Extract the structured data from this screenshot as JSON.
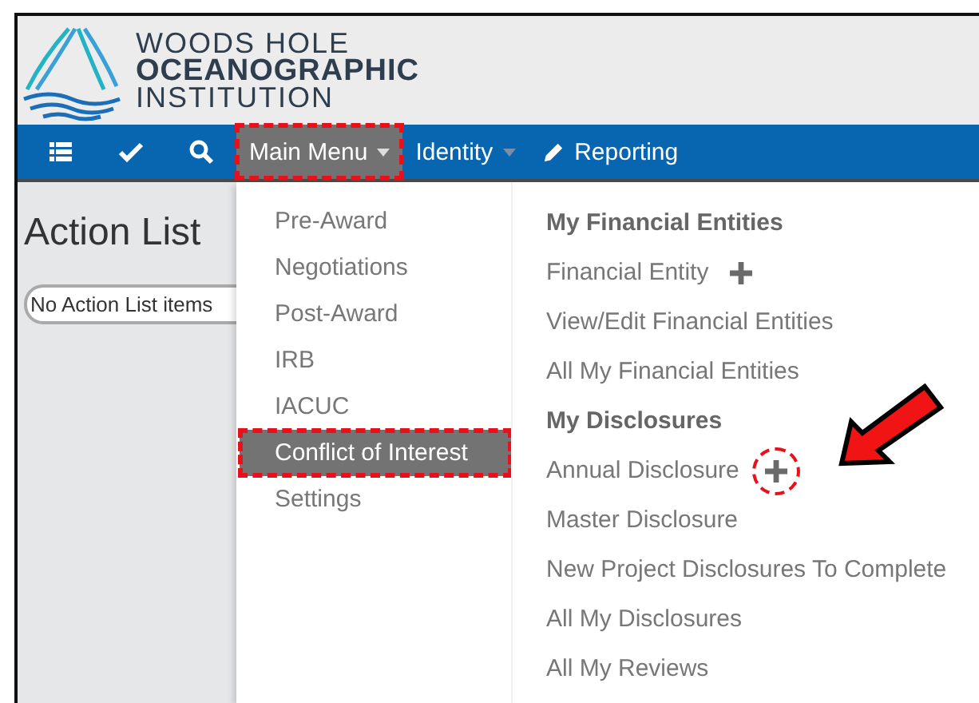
{
  "logo": {
    "lines": [
      "WOODS HOLE",
      "OCEANOGRAPHIC",
      "INSTITUTION"
    ]
  },
  "navbar": {
    "items": [
      {
        "kind": "list-icon",
        "highlighted": false
      },
      {
        "kind": "check-icon",
        "highlighted": false
      },
      {
        "kind": "search-icon",
        "highlighted": false
      },
      {
        "kind": "menu",
        "label": "Main Menu",
        "caret": true,
        "open": true,
        "highlighted": true
      },
      {
        "kind": "menu",
        "label": "Identity",
        "caret": true,
        "open": false,
        "highlighted": false
      },
      {
        "kind": "pencil",
        "label": "Reporting",
        "highlighted": false
      }
    ]
  },
  "action_list": {
    "title": "Action List",
    "message": "No Action List items"
  },
  "main_menu": {
    "items": [
      {
        "label": "Pre-Award",
        "selected": false,
        "highlighted": false
      },
      {
        "label": "Negotiations",
        "selected": false,
        "highlighted": false
      },
      {
        "label": "Post-Award",
        "selected": false,
        "highlighted": false
      },
      {
        "label": "IRB",
        "selected": false,
        "highlighted": false
      },
      {
        "label": "IACUC",
        "selected": false,
        "highlighted": false
      },
      {
        "label": "Conflict of Interest",
        "selected": true,
        "highlighted": true
      },
      {
        "label": "Settings",
        "selected": false,
        "highlighted": false
      }
    ],
    "submenu": [
      {
        "kind": "heading",
        "label": "My Financial Entities"
      },
      {
        "kind": "link",
        "label": "Financial Entity",
        "add": true,
        "annotated": false
      },
      {
        "kind": "link",
        "label": "View/Edit Financial Entities",
        "add": false
      },
      {
        "kind": "link",
        "label": "All My Financial Entities",
        "add": false
      },
      {
        "kind": "heading",
        "label": "My Disclosures"
      },
      {
        "kind": "link",
        "label": "Annual Disclosure",
        "add": true,
        "annotated": true
      },
      {
        "kind": "link",
        "label": "Master Disclosure",
        "add": false
      },
      {
        "kind": "link",
        "label": "New Project Disclosures To Complete",
        "add": false
      },
      {
        "kind": "link",
        "label": "All My Disclosures",
        "add": false
      },
      {
        "kind": "link",
        "label": "All My Reviews",
        "add": false
      }
    ]
  }
}
